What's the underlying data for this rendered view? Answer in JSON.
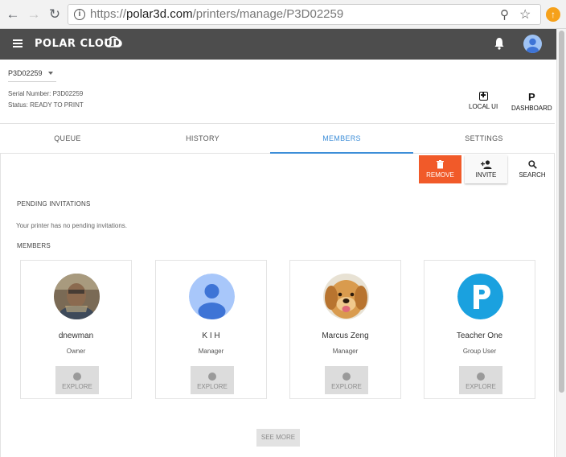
{
  "browser": {
    "url_prefix": "https://",
    "url_host": "polar3d.com",
    "url_path": "/printers/manage/P3D02259"
  },
  "header": {
    "logo_text": "POLAR CLOUD"
  },
  "printer": {
    "selected": "P3D02259",
    "serial": "Serial Number: P3D02259",
    "status": "Status: READY TO PRINT"
  },
  "toolbar": {
    "local_ui": "LOCAL UI",
    "dashboard_icon": "P",
    "dashboard": "DASHBOARD"
  },
  "tabs": [
    {
      "label": "QUEUE"
    },
    {
      "label": "HISTORY"
    },
    {
      "label": "MEMBERS"
    },
    {
      "label": "SETTINGS"
    }
  ],
  "active_tab": "MEMBERS",
  "actions": {
    "remove": "REMOVE",
    "invite": "INVITE",
    "search": "SEARCH"
  },
  "pending": {
    "title": "PENDING INVITATIONS",
    "note": "Your printer has no pending invitations."
  },
  "members": {
    "title": "MEMBERS",
    "cards": [
      {
        "name": "dnewman",
        "role": "Owner",
        "explore": "EXPLORE",
        "avatar": "photo-avatar"
      },
      {
        "name": "K I H",
        "role": "Manager",
        "explore": "EXPLORE",
        "avatar": "default-person-avatar"
      },
      {
        "name": "Marcus Zeng",
        "role": "Manager",
        "explore": "EXPLORE",
        "avatar": "dog-photo-avatar"
      },
      {
        "name": "Teacher One",
        "role": "Group User",
        "explore": "EXPLORE",
        "avatar": "letter-p-avatar"
      }
    ],
    "see_more": "SEE MORE"
  },
  "colors": {
    "header_bg": "#4d4d4d",
    "accent": "#3d8ed8",
    "remove": "#f15a29"
  }
}
